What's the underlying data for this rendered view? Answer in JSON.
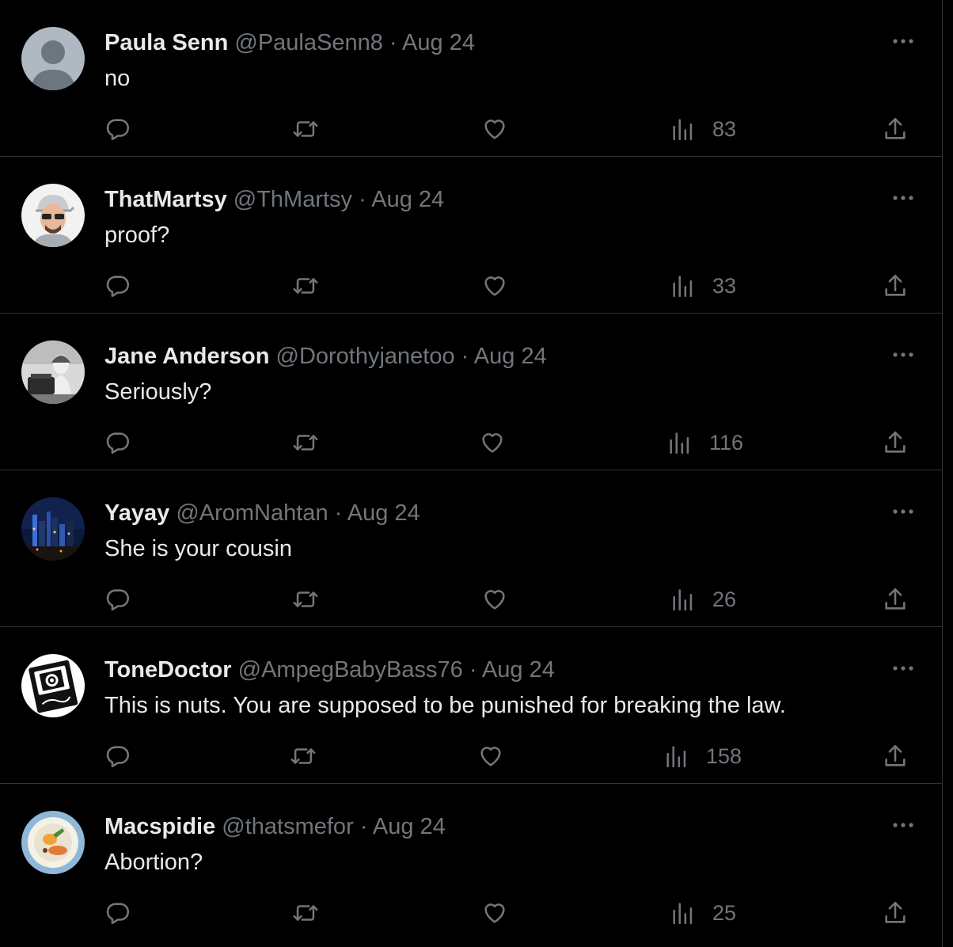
{
  "tweets": [
    {
      "name": "Paula Senn",
      "handle": "@PaulaSenn8",
      "date": "Aug 24",
      "text": "no",
      "views": "83",
      "avatar": "default-avatar"
    },
    {
      "name": "ThatMartsy",
      "handle": "@ThMartsy",
      "date": "Aug 24",
      "text": "proof?",
      "views": "33",
      "avatar": "sunglasses-man-avatar"
    },
    {
      "name": "Jane Anderson",
      "handle": "@Dorothyjanetoo",
      "date": "Aug 24",
      "text": "Seriously?",
      "views": "116",
      "avatar": "vintage-photo-avatar"
    },
    {
      "name": "Yayay",
      "handle": "@AromNahtan",
      "date": "Aug 24",
      "text": "She is your cousin",
      "views": "26",
      "avatar": "city-skyline-avatar"
    },
    {
      "name": "ToneDoctor",
      "handle": "@AmpegBabyBass76",
      "date": "Aug 24",
      "text": "This is nuts. You are supposed to be punished for breaking the law.",
      "views": "158",
      "avatar": "ampeg-logo-avatar"
    },
    {
      "name": "Macspidie",
      "handle": "@thatsmefor",
      "date": "Aug 24",
      "text": "Abortion?",
      "views": "25",
      "avatar": "food-plate-avatar"
    }
  ],
  "separator": " · ",
  "colors": {
    "background": "#000000",
    "text": "#e7e9ea",
    "muted": "#71767b",
    "divider": "#2f3336"
  },
  "icons": [
    "reply-icon",
    "retweet-icon",
    "like-icon",
    "views-icon",
    "share-icon",
    "more-icon"
  ]
}
